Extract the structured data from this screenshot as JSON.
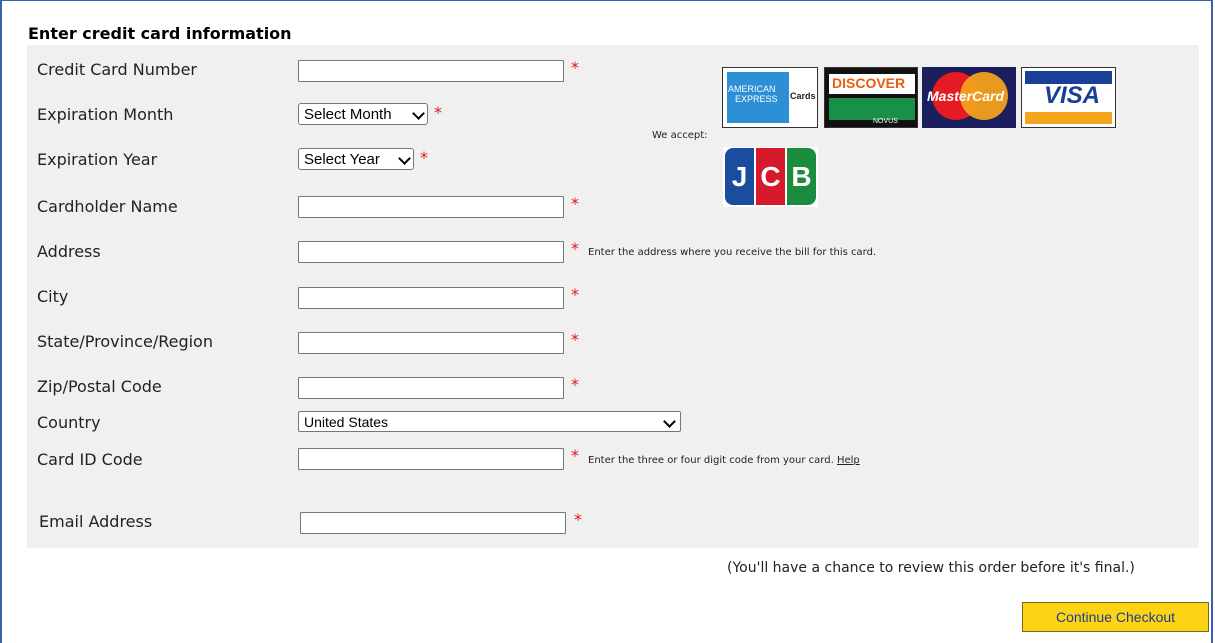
{
  "form": {
    "title": "Enter credit card information",
    "required_mark": "*",
    "fields": {
      "card_number": {
        "label": "Credit Card Number",
        "value": ""
      },
      "exp_month": {
        "label": "Expiration Month",
        "selected": "Select Month"
      },
      "exp_year": {
        "label": "Expiration Year",
        "selected": "Select Year"
      },
      "cardholder": {
        "label": "Cardholder Name",
        "value": ""
      },
      "address": {
        "label": "Address",
        "value": "",
        "hint": "Enter the address where you receive the bill for this card."
      },
      "city": {
        "label": "City",
        "value": ""
      },
      "state": {
        "label": "State/Province/Region",
        "value": ""
      },
      "zip": {
        "label": "Zip/Postal Code",
        "value": ""
      },
      "country": {
        "label": "Country",
        "selected": "United States"
      },
      "card_id": {
        "label": "Card ID Code",
        "value": "",
        "hint": "Enter the three or four digit code from your card.",
        "help_link": "Help"
      },
      "email": {
        "label": "Email Address",
        "value": ""
      }
    },
    "we_accept": "We accept:",
    "cards": {
      "amex": {
        "line1": "AMERICAN",
        "line2": "EXPRESS",
        "suffix": "Cards"
      },
      "discover": {
        "text": "DISCOVER",
        "sub": "NOVUS"
      },
      "mastercard": {
        "text": "MasterCard"
      },
      "visa": {
        "text": "VISA"
      },
      "jcb": {
        "j": "J",
        "c": "C",
        "b": "B"
      }
    },
    "review_note": "(You'll have a chance to review this order before it's final.)",
    "continue_button": "Continue Checkout"
  },
  "colors": {
    "required": "#e0191b",
    "button": "#fdd415",
    "button_text": "#1a3e8c",
    "panel": "#f0f0f0",
    "frame": "#3a5fae"
  }
}
